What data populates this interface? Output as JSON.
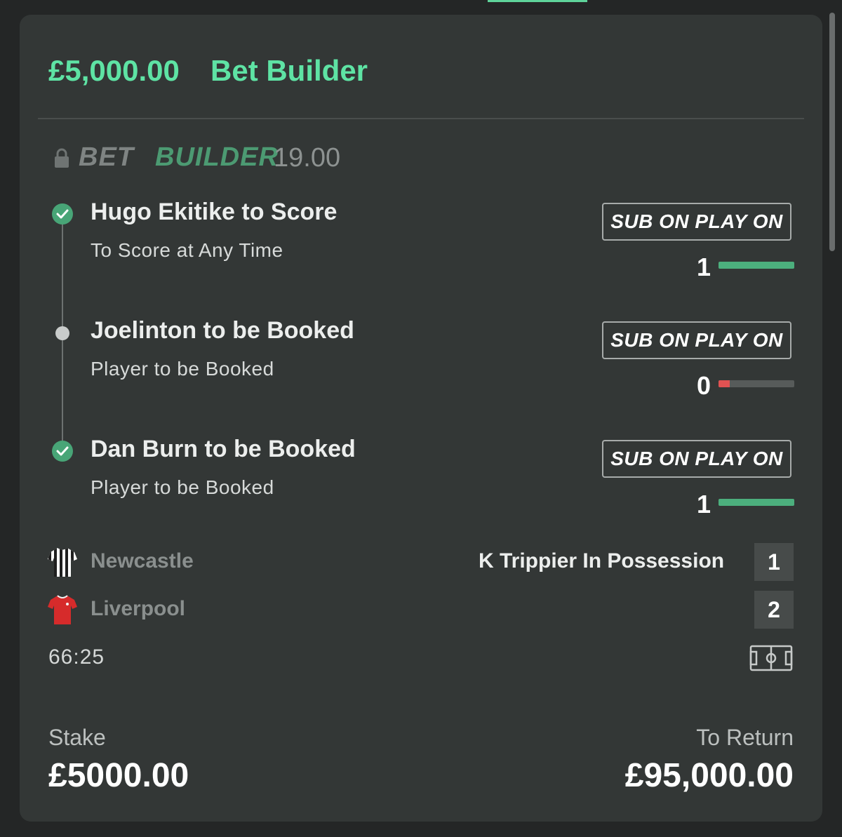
{
  "header": {
    "amount": "£5,000.00",
    "title": "Bet Builder"
  },
  "bet_builder": {
    "label_part1": "BET",
    "label_part2": "BUILDER",
    "odds": "19.00",
    "icon": "lock-icon"
  },
  "selections": [
    {
      "title": "Hugo Ekitike to Score",
      "market": "To Score at Any Time",
      "status": "won",
      "button_label": "SUB ON PLAY ON",
      "progress_count": "1",
      "progress_fraction": 1.0,
      "progress_color": "#4caf7d"
    },
    {
      "title": "Joelinton to be Booked",
      "market": "Player to be Booked",
      "status": "pending",
      "button_label": "SUB ON PLAY ON",
      "progress_count": "0",
      "progress_fraction": 0.15,
      "progress_color": "#e05252"
    },
    {
      "title": "Dan Burn to be Booked",
      "market": "Player to be Booked",
      "status": "won",
      "button_label": "SUB ON PLAY ON",
      "progress_count": "1",
      "progress_fraction": 1.0,
      "progress_color": "#4caf7d"
    }
  ],
  "match": {
    "home_team": "Newcastle",
    "away_team": "Liverpool",
    "home_icon": "striped-shirt-icon",
    "away_icon": "red-shirt-icon",
    "possession_text": "K Trippier In Possession",
    "home_score": "1",
    "away_score": "2",
    "clock": "66:25",
    "pitch_icon": "pitch-icon"
  },
  "footer": {
    "stake_label": "Stake",
    "stake_value": "£5000.00",
    "return_label": "To Return",
    "return_value": "£95,000.00"
  },
  "colors": {
    "accent": "#5ee3a4",
    "card_bg": "#333736",
    "page_bg": "#242626",
    "success": "#48a577",
    "danger": "#e05252"
  }
}
